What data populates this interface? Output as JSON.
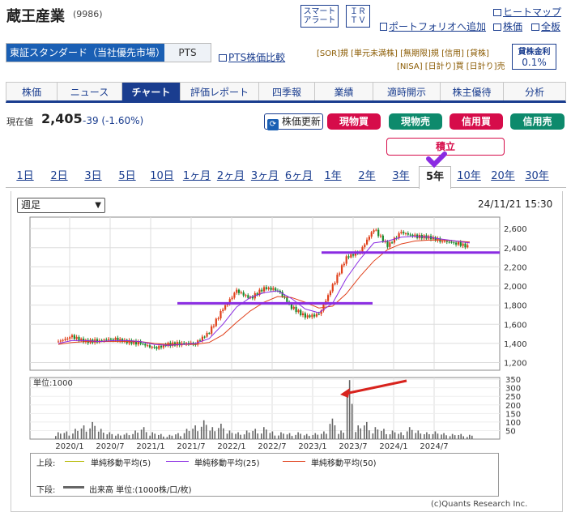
{
  "header": {
    "company": "蔵王産業",
    "code": "(9986)",
    "smart_alert_1": "スマート",
    "smart_alert_2": "アラート",
    "ir_1": "ＩＲ",
    "ir_2": "ＴＶ",
    "portfolio": "ポートフォリオへ追加",
    "heatmap": "ヒートマップ",
    "stock_price": "株価",
    "all_board": "全板"
  },
  "market": {
    "selected": "東証スタンダード（当社優先市場）",
    "pts": "PTS",
    "pts_compare": "PTS株価比較"
  },
  "badges": {
    "row1": [
      "SOR",
      "単元未満株",
      "無期限",
      "信用",
      "貸株"
    ],
    "sor_mark": "SOR",
    "row1_text": "[SOR]規 [単元未満株] [無期限]規 [信用] [貸株]",
    "row2_text": "[NISA] [日計り]買 [日計り]売",
    "lending_label": "貸株金利",
    "lending_rate": "0.1%"
  },
  "nav_tabs": [
    "株価",
    "ニュース",
    "チャート",
    "評価レポート",
    "四季報",
    "業績",
    "適時開示",
    "株主優待",
    "分析"
  ],
  "active_tab": "チャート",
  "quote": {
    "label": "現在値",
    "price": "2,405",
    "change": "-39 (-1.60%)",
    "refresh": "株価更新",
    "buy_cash": "現物買",
    "sell_cash": "現物売",
    "buy_margin": "信用買",
    "sell_margin": "信用売",
    "accumulate": "積立"
  },
  "periods": [
    "1日",
    "2日",
    "3日",
    "5日",
    "10日",
    "1ヶ月",
    "2ヶ月",
    "3ヶ月",
    "6ヶ月",
    "1年",
    "2年",
    "3年",
    "5年",
    "10年",
    "20年",
    "30年"
  ],
  "active_period": "5年",
  "chart_controls": {
    "interval": "週足",
    "timestamp": "24/11/21 15:30",
    "volume_unit_label": "単位:1000"
  },
  "legend": {
    "upper_label": "上段:",
    "ma5": "単純移動平均(5)",
    "ma25": "単純移動平均(25)",
    "ma50": "単純移動平均(50)",
    "lower_label": "下段:",
    "volume": "出来高 単位:(1000株/口/枚)",
    "credit": "(c)Quants Research Inc."
  },
  "colors": {
    "ma5": "#b5b800",
    "ma25": "#8a2be2",
    "ma50": "#e0401b",
    "candle_up": "#e0401b",
    "candle_down": "#1a8a2e",
    "volume": "#666666",
    "support_line": "#8a2be2",
    "arrow": "#d8231d",
    "nav_active": "#1a3d8f",
    "buy": "#d60c4a",
    "sell": "#0d8a6c"
  },
  "chart_data": {
    "type": "line",
    "title": "",
    "x_tick_labels": [
      "2020/1",
      "2020/7",
      "2021/1",
      "2021/7",
      "2022/1",
      "2022/7",
      "2023/1",
      "2023/7",
      "2024/1",
      "2024/7"
    ],
    "price_tick_labels": [
      "2,600",
      "2,400",
      "2,200",
      "2,000",
      "1,800",
      "1,600",
      "1,400",
      "1,200"
    ],
    "price_ylim": [
      1120,
      2720
    ],
    "volume_tick_labels": [
      "350",
      "300",
      "250",
      "200",
      "150",
      "100",
      "50"
    ],
    "volume_ylim": [
      0,
      360
    ],
    "price_series": {
      "x": [
        "2019/11",
        "2020/1",
        "2020/3",
        "2020/5",
        "2020/7",
        "2020/9",
        "2020/11",
        "2021/1",
        "2021/3",
        "2021/5",
        "2021/7",
        "2021/9",
        "2021/11",
        "2022/1",
        "2022/3",
        "2022/5",
        "2022/7",
        "2022/9",
        "2022/11",
        "2023/1",
        "2023/3",
        "2023/5",
        "2023/7",
        "2023/9",
        "2023/11",
        "2024/1",
        "2024/3",
        "2024/5",
        "2024/7",
        "2024/9",
        "2024/11"
      ],
      "values": [
        1420,
        1470,
        1420,
        1430,
        1450,
        1420,
        1400,
        1350,
        1390,
        1400,
        1400,
        1520,
        1760,
        1950,
        1870,
        1980,
        1960,
        1780,
        1680,
        1700,
        2000,
        2300,
        2360,
        2600,
        2420,
        2560,
        2520,
        2510,
        2470,
        2450,
        2405
      ]
    },
    "ma25_values": [
      1400,
      1430,
      1430,
      1420,
      1430,
      1430,
      1420,
      1390,
      1380,
      1390,
      1400,
      1450,
      1600,
      1780,
      1880,
      1930,
      1950,
      1870,
      1760,
      1720,
      1820,
      2080,
      2280,
      2450,
      2470,
      2510,
      2520,
      2510,
      2490,
      2470,
      2450
    ],
    "ma50_values": [
      1390,
      1410,
      1420,
      1420,
      1420,
      1420,
      1420,
      1400,
      1390,
      1390,
      1390,
      1410,
      1490,
      1620,
      1740,
      1830,
      1890,
      1880,
      1830,
      1770,
      1790,
      1920,
      2100,
      2260,
      2380,
      2440,
      2470,
      2480,
      2480,
      2470,
      2460
    ],
    "volume_series": {
      "values": [
        40,
        45,
        60,
        80,
        100,
        60,
        40,
        30,
        35,
        50,
        70,
        40,
        30,
        25,
        35,
        60,
        80,
        110,
        70,
        90,
        50,
        40,
        50,
        60,
        70,
        45,
        40,
        35,
        40,
        30,
        35,
        45,
        120,
        50,
        345,
        80,
        100,
        70,
        60,
        50,
        40,
        70,
        50,
        40,
        45,
        35,
        30,
        30,
        25
      ]
    },
    "support_lines": [
      1820,
      2350
    ]
  }
}
